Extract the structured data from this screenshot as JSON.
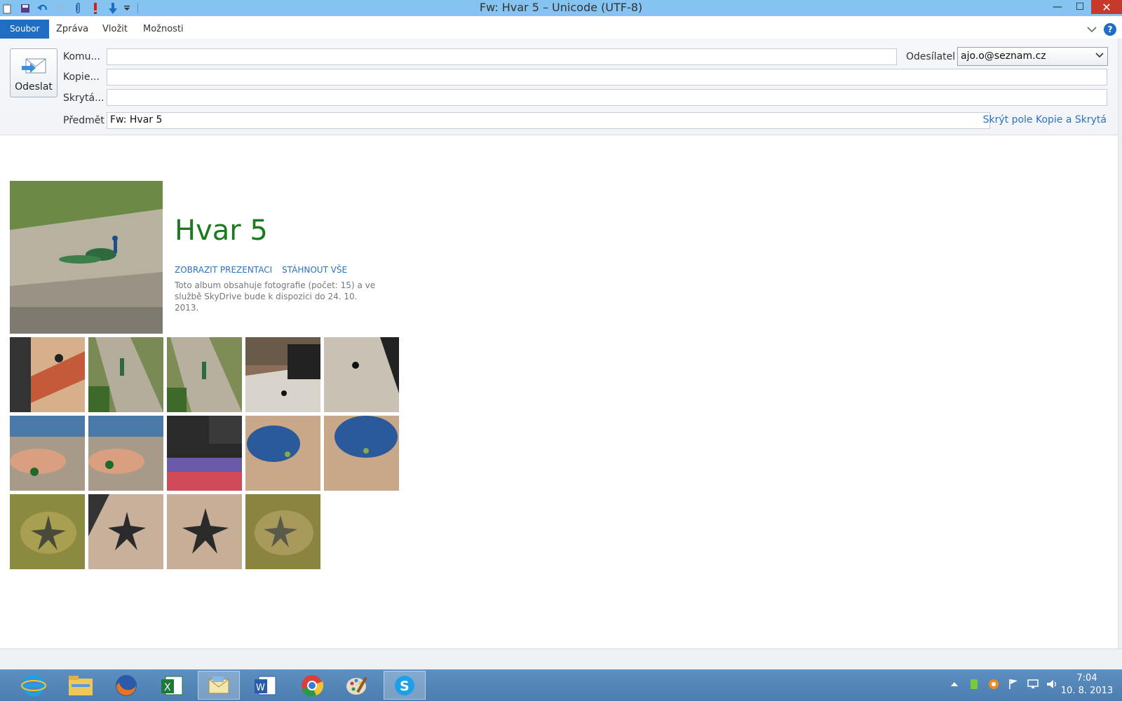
{
  "window": {
    "title": "Fw: Hvar 5 – Unicode (UTF-8)",
    "controls": {
      "minimize": "—",
      "maximize": "☐",
      "close": "✕"
    }
  },
  "quick_access": {
    "icons": [
      "paste-icon",
      "save-icon",
      "undo-icon",
      "redo-icon",
      "attach-icon",
      "importance-icon",
      "down-arrow-icon",
      "customize-icon"
    ]
  },
  "ribbon": {
    "tabs": [
      "Soubor",
      "Zpráva",
      "Vložit",
      "Možnosti"
    ],
    "help": "?"
  },
  "compose": {
    "send_label": "Odeslat",
    "to_label": "Komu...",
    "cc_label": "Kopie...",
    "bcc_label": "Skrytá...",
    "subject_label": "Předmět",
    "to_value": "",
    "cc_value": "",
    "bcc_value": "",
    "subject_value": "Fw: Hvar 5",
    "sender_label": "Odesílatel",
    "sender_value": "ajo.o@seznam.cz",
    "hide_link": "Skrýt pole Kopie a Skrytá"
  },
  "album": {
    "title": "Hvar 5",
    "show_slideshow": "ZOBRAZIT PREZENTACI",
    "download_all": "STÁHNOUT VŠE",
    "description": "Toto album obsahuje fotografie (počet: 15) a ve službě SkyDrive bude k dispozici do 24. 10. 2013."
  },
  "taskbar": {
    "apps": [
      "internet-explorer-icon",
      "file-explorer-icon",
      "firefox-icon",
      "excel-icon",
      "mail-icon",
      "word-icon",
      "chrome-icon",
      "paint-icon",
      "skype-icon"
    ],
    "time": "7:04",
    "date": "10. 8. 2013"
  },
  "colors": {
    "titlebar": "#85c4f0",
    "accent": "#1e6fc3",
    "album_title": "#1b7a1b",
    "link": "#2a72c4",
    "taskbar": "#5d8fc0"
  }
}
